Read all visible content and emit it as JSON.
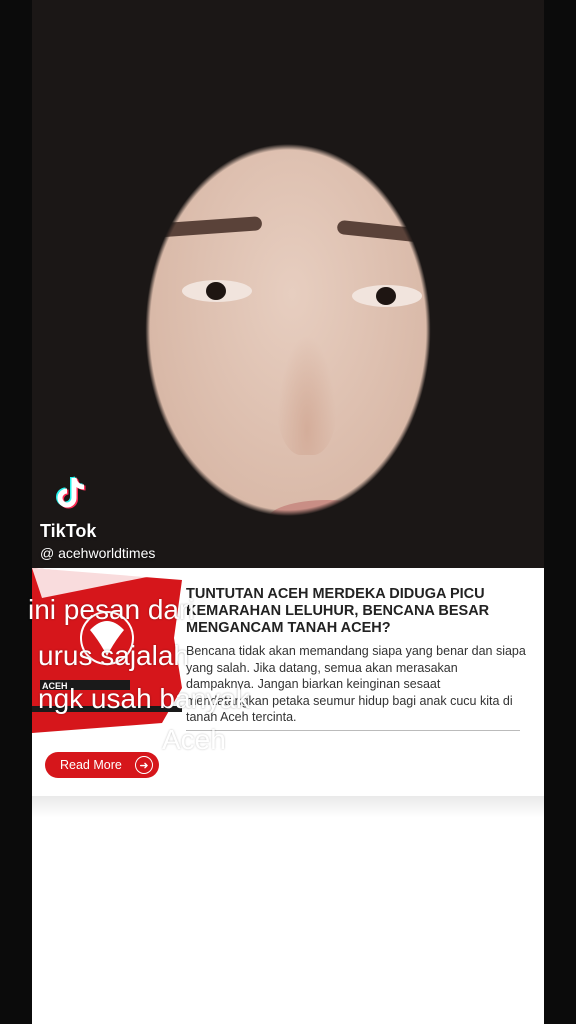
{
  "watermark": {
    "brand": "TikTok",
    "handle": "@ acehworldtimes",
    "logo_icon": "tiktok-note-icon"
  },
  "article": {
    "headline": "TUNTUTAN ACEH MERDEKA DIDUGA PICU KEMARAHAN LELUHUR, BENCANA BESAR MENGANCAM TANAH ACEH?",
    "excerpt": "Bencana tidak akan memandang siapa yang benar dan siapa yang salah. Jika datang, semua akan merasakan dampaknya. Jangan biarkan keinginan sesaat mendatangkan petaka seumur hidup bagi anak cucu kita di tanah Aceh tercinta.",
    "read_more": "Read More",
    "read_more_icon": "arrow-right-circle-icon",
    "thumb_label": "ACEH",
    "accent": "#d6161b"
  },
  "captions": {
    "line1": "ini pesan dari",
    "line2": "urus sajalah",
    "line3": "ngk usah banyak",
    "line4": "Aceh"
  }
}
